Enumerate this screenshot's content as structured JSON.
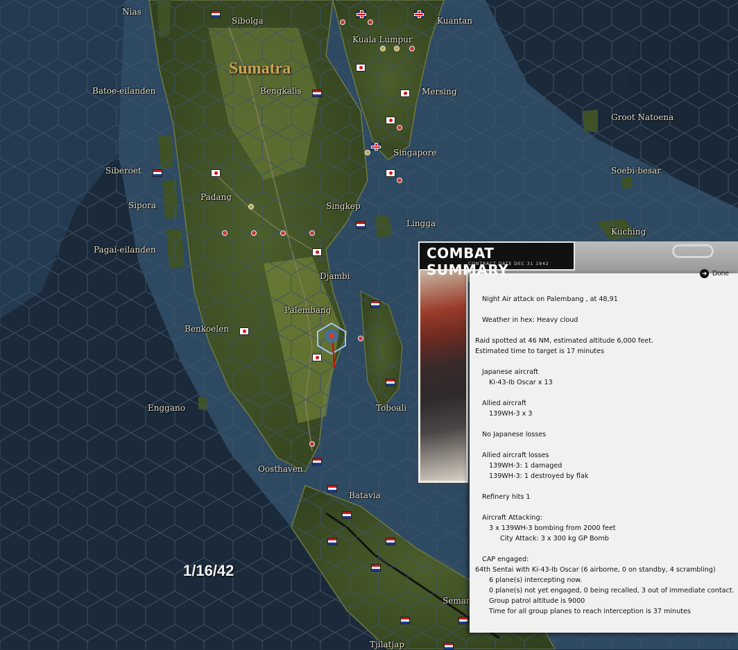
{
  "map": {
    "region_label": "Sumatra",
    "date": "1/16/42",
    "places": [
      {
        "id": "nias",
        "name": "Nias"
      },
      {
        "id": "sibolga",
        "name": "Sibolga"
      },
      {
        "id": "kuala-lumpur",
        "name": "Kuala Lumpur"
      },
      {
        "id": "kuantan",
        "name": "Kuantan"
      },
      {
        "id": "batoe",
        "name": "Batoe-eilanden"
      },
      {
        "id": "bengkalis",
        "name": "Bengkalis"
      },
      {
        "id": "mersing",
        "name": "Mersing"
      },
      {
        "id": "groot-natoena",
        "name": "Groot Natoena"
      },
      {
        "id": "singapore",
        "name": "Singapore"
      },
      {
        "id": "siberoet",
        "name": "Siberoet"
      },
      {
        "id": "soebi-besar",
        "name": "Soebi-besar"
      },
      {
        "id": "padang",
        "name": "Padang"
      },
      {
        "id": "sipora",
        "name": "Sipora"
      },
      {
        "id": "singkep",
        "name": "Singkep"
      },
      {
        "id": "lingga",
        "name": "Lingga"
      },
      {
        "id": "kuching",
        "name": "Kuching"
      },
      {
        "id": "pagai",
        "name": "Pagai-eilanden"
      },
      {
        "id": "djambi",
        "name": "Djambi"
      },
      {
        "id": "palembang",
        "name": "Palembang"
      },
      {
        "id": "benkoelen",
        "name": "Benkoelen"
      },
      {
        "id": "enggano",
        "name": "Enggano"
      },
      {
        "id": "toboali",
        "name": "Toboali"
      },
      {
        "id": "oosthaven",
        "name": "Oosthaven"
      },
      {
        "id": "batavia",
        "name": "Batavia"
      },
      {
        "id": "semar",
        "name": "Semar"
      },
      {
        "id": "tjilatjap",
        "name": "Tjilatjap"
      }
    ]
  },
  "combat_summary": {
    "title": "COMBAT SUMMARY",
    "subtitle": "CONTRACT DATE DEC 31 1942",
    "done_label": "Done",
    "lines": [
      {
        "text": "Night Air attack on Palembang , at 48,91",
        "indent": 1,
        "gap": false
      },
      {
        "text": "Weather in hex: Heavy cloud",
        "indent": 1,
        "gap": true
      },
      {
        "text": "Raid spotted at 46 NM, estimated altitude 6,000 feet.",
        "indent": 0,
        "gap": true
      },
      {
        "text": "Estimated time to target is 17 minutes",
        "indent": 0,
        "gap": false
      },
      {
        "text": "Japanese aircraft",
        "indent": 1,
        "gap": true
      },
      {
        "text": "Ki-43-Ib Oscar x 13",
        "indent": 2,
        "gap": false
      },
      {
        "text": "Allied aircraft",
        "indent": 1,
        "gap": true
      },
      {
        "text": "139WH-3 x 3",
        "indent": 2,
        "gap": false
      },
      {
        "text": "No Japanese losses",
        "indent": 1,
        "gap": true
      },
      {
        "text": "Allied aircraft losses",
        "indent": 1,
        "gap": true
      },
      {
        "text": "139WH-3: 1 damaged",
        "indent": 2,
        "gap": false
      },
      {
        "text": "139WH-3: 1 destroyed by flak",
        "indent": 2,
        "gap": false
      },
      {
        "text": "Refinery hits 1",
        "indent": 1,
        "gap": true
      },
      {
        "text": "Aircraft Attacking:",
        "indent": 1,
        "gap": true
      },
      {
        "text": "3 x 139WH-3 bombing from 2000 feet",
        "indent": 2,
        "gap": false
      },
      {
        "text": "City Attack: 3 x 300 kg GP Bomb",
        "indent": 3,
        "gap": false
      },
      {
        "text": "CAP engaged:",
        "indent": 1,
        "gap": true
      },
      {
        "text": "64th Sentai with Ki-43-Ib Oscar (6 airborne, 0 on standby, 4 scrambling)",
        "indent": 0,
        "gap": false
      },
      {
        "text": "6 plane(s) intercepting now.",
        "indent": 2,
        "gap": false
      },
      {
        "text": "0 plane(s) not yet engaged, 0 being recalled, 3 out of immediate contact.",
        "indent": 2,
        "gap": false
      },
      {
        "text": "Group patrol altitude is 9000",
        "indent": 2,
        "gap": false
      },
      {
        "text": "Time for all group planes to reach interception is 37 minutes",
        "indent": 2,
        "gap": false
      }
    ]
  }
}
